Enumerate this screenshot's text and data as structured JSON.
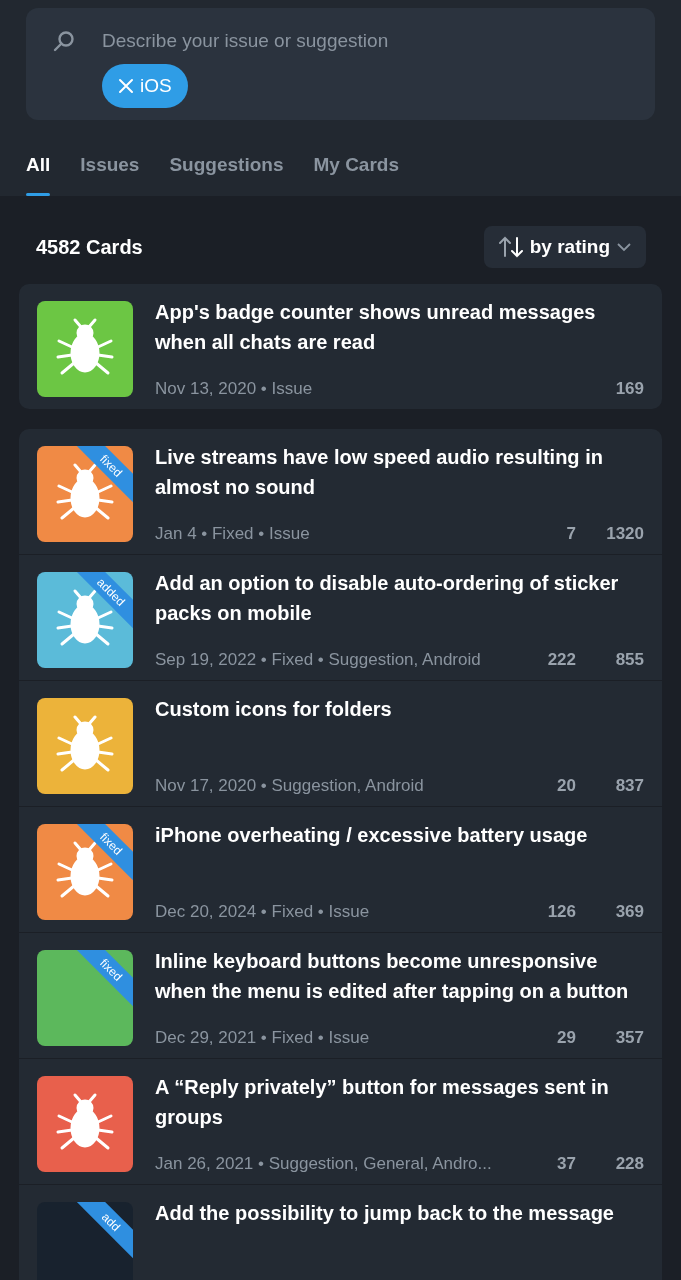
{
  "search": {
    "placeholder": "Describe your issue or suggestion",
    "chips": [
      {
        "label": "iOS"
      }
    ]
  },
  "tabs": [
    {
      "label": "All",
      "selected": true
    },
    {
      "label": "Issues",
      "selected": false
    },
    {
      "label": "Suggestions",
      "selected": false
    },
    {
      "label": "My Cards",
      "selected": false
    }
  ],
  "count": "4582 Cards",
  "sort": {
    "label": "by rating"
  },
  "groups": [
    {
      "cards": [
        {
          "kind": "icon",
          "color": "#6cc644",
          "title": "App's badge counter shows unread messages when all chats are read",
          "meta": "Nov 13, 2020 • Issue",
          "stat_2": "169"
        }
      ]
    },
    {
      "cards": [
        {
          "kind": "icon",
          "color": "#f08a45",
          "ribbon": "fixed",
          "title": "Live streams have low speed audio resulting in almost no sound",
          "meta": "Jan 4 • Fixed • Issue",
          "stat_1": "7",
          "stat_2": "1320"
        },
        {
          "kind": "icon",
          "color": "#5bbbd9",
          "ribbon": "added",
          "title": "Add an option to disable auto-ordering of sticker packs on mobile",
          "meta": "Sep 19, 2022 • Fixed • Suggestion, Android",
          "stat_1": "222",
          "stat_2": "855"
        },
        {
          "kind": "icon",
          "color": "#ecb33a",
          "title": "Custom icons for folders",
          "meta": "Nov 17, 2020 • Suggestion, Android",
          "stat_1": "20",
          "stat_2": "837"
        },
        {
          "kind": "icon",
          "color": "#f08a45",
          "ribbon": "fixed",
          "title": "iPhone overheating / excessive battery usage",
          "meta": "Dec 20, 2024 • Fixed • Issue",
          "stat_1": "126",
          "stat_2": "369"
        },
        {
          "kind": "screenshot",
          "color": "#5cb85c",
          "ribbon": "fixed",
          "title": "Inline keyboard buttons become unresponsive when the menu is edited after tapping on a button",
          "meta": "Dec 29, 2021 • Fixed • Issue",
          "stat_1": "29",
          "stat_2": "357"
        },
        {
          "kind": "icon",
          "color": "#e8604c",
          "title": "A “Reply privately” button for messages sent in groups",
          "meta": "Jan 26, 2021 • Suggestion, General, Andro...",
          "stat_1": "37",
          "stat_2": "228"
        },
        {
          "kind": "photo",
          "color": "#18222e",
          "ribbon": "add",
          "title": "Add the possibility to jump back to the message"
        }
      ]
    }
  ]
}
